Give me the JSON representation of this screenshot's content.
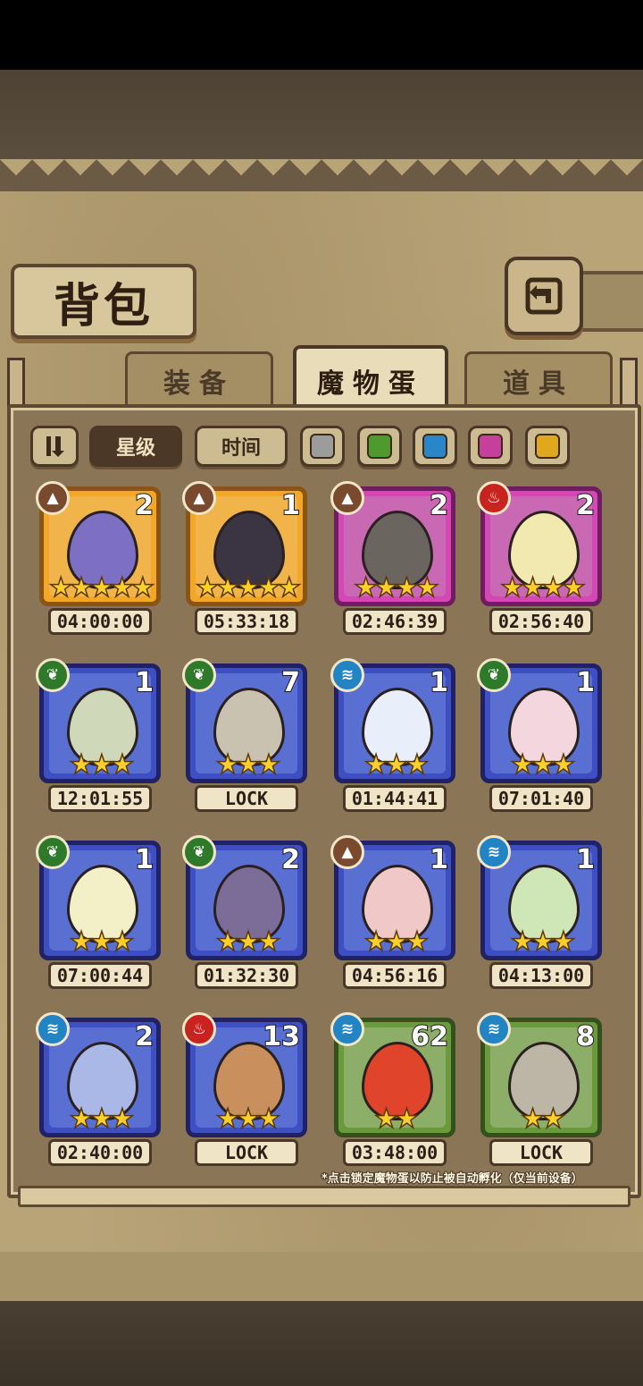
{
  "title": "背包",
  "tabs": [
    {
      "label": "装备"
    },
    {
      "label": "魔物蛋"
    },
    {
      "label": "道具"
    }
  ],
  "filters": {
    "star_label": "星级",
    "time_label": "时间",
    "colors": [
      "#9c9c9c",
      "#4f9a2f",
      "#2b86c9",
      "#c63f9c",
      "#e0a81c"
    ]
  },
  "eggs": [
    {
      "element": "earth",
      "count": "2",
      "stars": "★★★★★",
      "timer": "04:00:00",
      "rarity": "orange",
      "egg_color": "#7c6fc4"
    },
    {
      "element": "earth",
      "count": "1",
      "stars": "★★★★★",
      "timer": "05:33:18",
      "rarity": "orange",
      "egg_color": "#3b3442"
    },
    {
      "element": "earth",
      "count": "2",
      "stars": "★★★★",
      "timer": "02:46:39",
      "rarity": "pink",
      "egg_color": "#6b6560"
    },
    {
      "element": "fire",
      "count": "2",
      "stars": "★★★★",
      "timer": "02:56:40",
      "rarity": "pink",
      "egg_color": "#f2e9b0"
    },
    {
      "element": "nature",
      "count": "1",
      "stars": "★★★",
      "timer": "12:01:55",
      "rarity": "blue",
      "egg_color": "#cfd8b8"
    },
    {
      "element": "nature",
      "count": "7",
      "stars": "★★★",
      "timer": "LOCK",
      "rarity": "blue",
      "egg_color": "#c9c2b0"
    },
    {
      "element": "water",
      "count": "1",
      "stars": "★★★",
      "timer": "01:44:41",
      "rarity": "blue",
      "egg_color": "#e8eefa"
    },
    {
      "element": "nature",
      "count": "1",
      "stars": "★★★",
      "timer": "07:01:40",
      "rarity": "blue",
      "egg_color": "#f3d6de"
    },
    {
      "element": "nature",
      "count": "1",
      "stars": "★★★",
      "timer": "07:00:44",
      "rarity": "blue",
      "egg_color": "#f3efc6"
    },
    {
      "element": "nature",
      "count": "2",
      "stars": "★★★",
      "timer": "01:32:30",
      "rarity": "blue",
      "egg_color": "#7b6c98"
    },
    {
      "element": "earth",
      "count": "1",
      "stars": "★★★",
      "timer": "04:56:16",
      "rarity": "blue",
      "egg_color": "#f0c8c8"
    },
    {
      "element": "water",
      "count": "1",
      "stars": "★★★",
      "timer": "04:13:00",
      "rarity": "blue",
      "egg_color": "#cfe6b6"
    },
    {
      "element": "water",
      "count": "2",
      "stars": "★★★",
      "timer": "02:40:00",
      "rarity": "blue",
      "egg_color": "#a9b8e6"
    },
    {
      "element": "fire",
      "count": "13",
      "stars": "★★★",
      "timer": "LOCK",
      "rarity": "blue",
      "egg_color": "#c98f5c"
    },
    {
      "element": "water",
      "count": "62",
      "stars": "★★",
      "timer": "03:48:00",
      "rarity": "green",
      "egg_color": "#e0452c"
    },
    {
      "element": "water",
      "count": "8",
      "stars": "★★",
      "timer": "LOCK",
      "rarity": "green",
      "egg_color": "#bdb6a6"
    }
  ],
  "footnote": "*点击锁定魔物蛋以防止被自动孵化（仅当前设备）"
}
